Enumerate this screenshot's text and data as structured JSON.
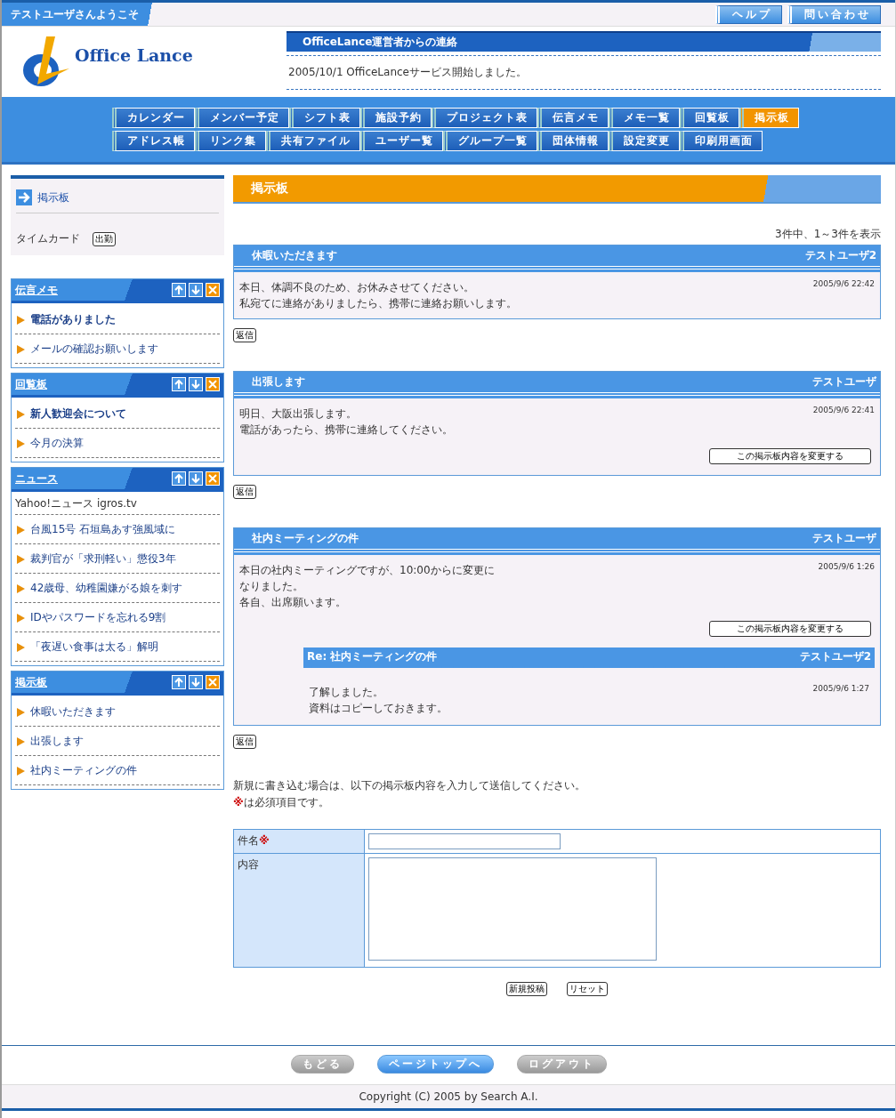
{
  "header": {
    "welcome": "テストユーザさんようこそ",
    "buttons": [
      "ヘルプ",
      "問い合わせ"
    ]
  },
  "logo": {
    "text": "Office Lance"
  },
  "notice": {
    "title": "OfficeLance運営者からの連絡",
    "text": "2005/10/1 OfficeLanceサービス開始しました。"
  },
  "nav": [
    [
      {
        "label": "カレンダー",
        "selected": false
      },
      {
        "label": "メンバー予定",
        "selected": false
      },
      {
        "label": "シフト表",
        "selected": false
      },
      {
        "label": "施設予約",
        "selected": false
      },
      {
        "label": "プロジェクト表",
        "selected": false
      },
      {
        "label": "伝言メモ",
        "selected": false
      },
      {
        "label": "メモ一覧",
        "selected": false
      },
      {
        "label": "回覧板",
        "selected": false
      },
      {
        "label": "掲示板",
        "selected": true
      }
    ],
    [
      {
        "label": "アドレス帳",
        "selected": false
      },
      {
        "label": "リンク集",
        "selected": false
      },
      {
        "label": "共有ファイル",
        "selected": false
      },
      {
        "label": "ユーザー覧",
        "selected": false
      },
      {
        "label": "グループ一覧",
        "selected": false
      },
      {
        "label": "団体情報",
        "selected": false
      },
      {
        "label": "設定変更",
        "selected": false
      },
      {
        "label": "印刷用画面",
        "selected": false
      }
    ]
  ],
  "sidebar": {
    "current": "掲示板",
    "timecard": {
      "label": "タイムカード",
      "button": "出勤"
    },
    "widgets": [
      {
        "title": "伝言メモ",
        "items": [
          {
            "text": "電話がありました",
            "unread": true
          },
          {
            "text": "メールの確認お願いします",
            "unread": false
          }
        ]
      },
      {
        "title": "回覧板",
        "items": [
          {
            "text": "新人歓迎会について",
            "unread": true
          },
          {
            "text": "今月の決算",
            "unread": false
          }
        ]
      },
      {
        "title": "ニュース",
        "source": "Yahoo!ニュース igros.tv",
        "items": [
          {
            "text": "台風15号 石垣島あす強風域に",
            "unread": false
          },
          {
            "text": "裁判官が「求刑軽い」懲役3年",
            "unread": false
          },
          {
            "text": "42歳母、幼稚園嫌がる娘を刺す",
            "unread": false
          },
          {
            "text": "IDやパスワードを忘れる9割",
            "unread": false
          },
          {
            "text": "「夜遅い食事は太る」解明",
            "unread": false
          }
        ]
      },
      {
        "title": "掲示板",
        "items": [
          {
            "text": "休暇いただきます",
            "unread": false
          },
          {
            "text": "出張します",
            "unread": false
          },
          {
            "text": "社内ミーティングの件",
            "unread": false
          }
        ]
      }
    ]
  },
  "board": {
    "title": "掲示板",
    "count": "3件中、1～3件を表示",
    "posts": [
      {
        "title": "休暇いただきます",
        "author": "テストユーザ2",
        "date": "2005/9/6 22:42",
        "lines": [
          "本日、体調不良のため、お休みさせてください。",
          "私宛てに連絡がありましたら、携帯に連絡お願いします。"
        ],
        "reply_button": "返信"
      },
      {
        "title": "出張します",
        "author": "テストユーザ",
        "date": "2005/9/6 22:41",
        "lines": [
          "明日、大阪出張します。",
          "電話があったら、携帯に連絡してください。"
        ],
        "edit_button": "この掲示板内容を変更する",
        "reply_button": "返信"
      },
      {
        "title": "社内ミーティングの件",
        "author": "テストユーザ",
        "date": "2005/9/6 1:26",
        "lines": [
          "本日の社内ミーティングですが、10:00からに変更に",
          "なりました。",
          "各自、出席願います。"
        ],
        "edit_button": "この掲示板内容を変更する",
        "replies": [
          {
            "title": "Re: 社内ミーティングの件",
            "author": "テストユーザ2",
            "date": "2005/9/6 1:27",
            "lines": [
              "了解しました。",
              "資料はコピーしておきます。"
            ]
          }
        ],
        "reply_button": "返信"
      }
    ]
  },
  "form": {
    "intro": "新規に書き込む場合は、以下の掲示板内容を入力して送信してください。",
    "required_note": {
      "mark": "※",
      "text": "は必須項目です。"
    },
    "fields": [
      {
        "label": "件名",
        "required_mark": "※",
        "kind": "text"
      },
      {
        "label": "内容",
        "kind": "textarea"
      }
    ],
    "buttons": [
      "新規投稿",
      "リセット"
    ]
  },
  "footer": {
    "buttons": [
      {
        "label": "もどる",
        "selected": false
      },
      {
        "label": "ページトップへ",
        "selected": true
      },
      {
        "label": "ログアウト",
        "selected": false
      }
    ],
    "copyright": "Copyright (C) 2005 by Search A.I."
  }
}
